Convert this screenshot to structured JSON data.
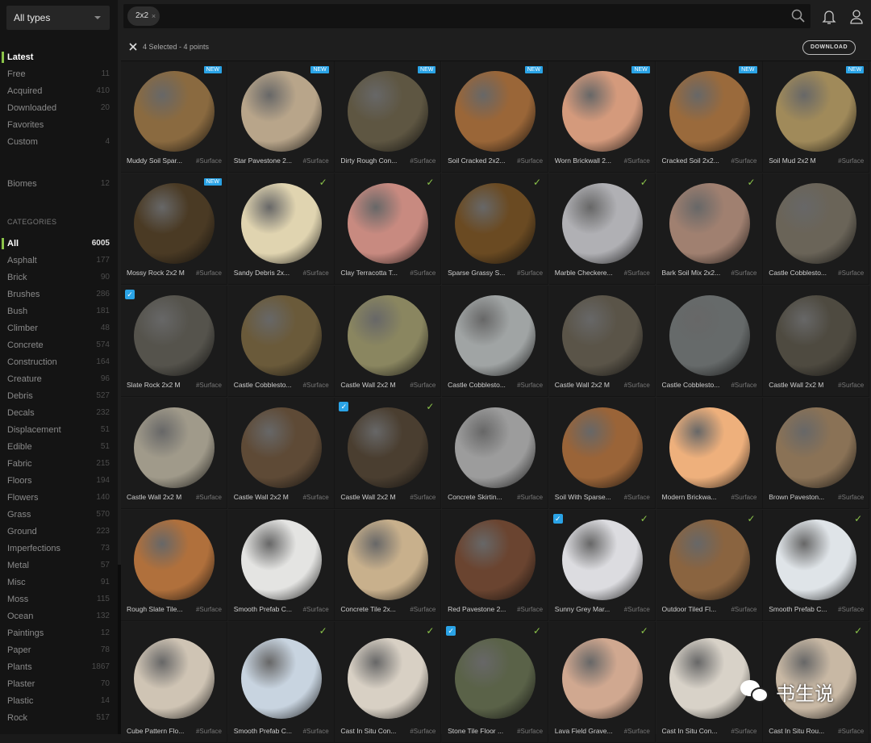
{
  "sidebar": {
    "type_select": "All types",
    "nav": [
      {
        "label": "Latest",
        "count": "",
        "active": true
      },
      {
        "label": "Free",
        "count": "11"
      },
      {
        "label": "Acquired",
        "count": "410"
      },
      {
        "label": "Downloaded",
        "count": "20"
      },
      {
        "label": "Favorites",
        "count": ""
      },
      {
        "label": "Custom",
        "count": "4"
      }
    ],
    "biomes": {
      "label": "Biomes",
      "count": "12"
    },
    "categories_heading": "CATEGORIES",
    "categories": [
      {
        "label": "All",
        "count": "6005",
        "active": true
      },
      {
        "label": "Asphalt",
        "count": "177"
      },
      {
        "label": "Brick",
        "count": "90"
      },
      {
        "label": "Brushes",
        "count": "286"
      },
      {
        "label": "Bush",
        "count": "181"
      },
      {
        "label": "Climber",
        "count": "48"
      },
      {
        "label": "Concrete",
        "count": "574"
      },
      {
        "label": "Construction",
        "count": "164"
      },
      {
        "label": "Creature",
        "count": "96"
      },
      {
        "label": "Debris",
        "count": "527"
      },
      {
        "label": "Decals",
        "count": "232"
      },
      {
        "label": "Displacement",
        "count": "51"
      },
      {
        "label": "Edible",
        "count": "51"
      },
      {
        "label": "Fabric",
        "count": "215"
      },
      {
        "label": "Floors",
        "count": "194"
      },
      {
        "label": "Flowers",
        "count": "140"
      },
      {
        "label": "Grass",
        "count": "570"
      },
      {
        "label": "Ground",
        "count": "223"
      },
      {
        "label": "Imperfections",
        "count": "73"
      },
      {
        "label": "Metal",
        "count": "57"
      },
      {
        "label": "Misc",
        "count": "91"
      },
      {
        "label": "Moss",
        "count": "115"
      },
      {
        "label": "Ocean",
        "count": "132"
      },
      {
        "label": "Paintings",
        "count": "12"
      },
      {
        "label": "Paper",
        "count": "78"
      },
      {
        "label": "Plants",
        "count": "1867"
      },
      {
        "label": "Plaster",
        "count": "70"
      },
      {
        "label": "Plastic",
        "count": "14"
      },
      {
        "label": "Rock",
        "count": "517"
      }
    ]
  },
  "header": {
    "search_chip": "2x2",
    "chip_close": "×",
    "icons": [
      "search-icon",
      "bell-icon",
      "user-icon"
    ]
  },
  "selection": {
    "text": "4 Selected - 4 points",
    "download": "DOWNLOAD"
  },
  "badges": {
    "new": "NEW",
    "check": "✓",
    "checkbox": "✓"
  },
  "accent": {
    "blue": "#2aa3e6",
    "green": "#8bc34a"
  },
  "assets": [
    {
      "name": "Muddy Soil Spar...",
      "tag": "#Surface",
      "color": "#8a6a40",
      "new": true
    },
    {
      "name": "Star Pavestone 2...",
      "tag": "#Surface",
      "color": "#b8a58a",
      "new": true
    },
    {
      "name": "Dirty Rough Con...",
      "tag": "#Surface",
      "color": "#5e5642",
      "new": true
    },
    {
      "name": "Soil Cracked 2x2...",
      "tag": "#Surface",
      "color": "#9a6638",
      "new": true
    },
    {
      "name": "Worn Brickwall 2...",
      "tag": "#Surface",
      "color": "#d49a7c",
      "new": true
    },
    {
      "name": "Cracked Soil 2x2...",
      "tag": "#Surface",
      "color": "#9a6a3c",
      "new": true
    },
    {
      "name": "Soil Mud 2x2 M",
      "tag": "#Surface",
      "color": "#a08a5a",
      "new": true
    },
    {
      "name": "Mossy Rock 2x2 M",
      "tag": "#Surface",
      "color": "#4a3a24",
      "new": true
    },
    {
      "name": "Sandy Debris 2x...",
      "tag": "#Surface",
      "color": "#e0d4b0",
      "check": true
    },
    {
      "name": "Clay Terracotta T...",
      "tag": "#Surface",
      "color": "#c88a80",
      "check": true
    },
    {
      "name": "Sparse Grassy S...",
      "tag": "#Surface",
      "color": "#6a4a22",
      "check": true
    },
    {
      "name": "Marble Checkere...",
      "tag": "#Surface",
      "color": "#b0b0b4",
      "check": true
    },
    {
      "name": "Bark Soil Mix 2x2...",
      "tag": "#Surface",
      "color": "#a08070",
      "check": true
    },
    {
      "name": "Castle Cobblesto...",
      "tag": "#Surface",
      "color": "#6a6458"
    },
    {
      "name": "Slate Rock 2x2 M",
      "tag": "#Surface",
      "color": "#55534c",
      "selected": true
    },
    {
      "name": "Castle Cobblesto...",
      "tag": "#Surface",
      "color": "#6a5a3a"
    },
    {
      "name": "Castle Wall 2x2 M",
      "tag": "#Surface",
      "color": "#8a8660"
    },
    {
      "name": "Castle Cobblesto...",
      "tag": "#Surface",
      "color": "#a0a4a4"
    },
    {
      "name": "Castle Wall 2x2 M",
      "tag": "#Surface",
      "color": "#5a5448"
    },
    {
      "name": "Castle Cobblesto...",
      "tag": "#Surface",
      "color": "#666a6a"
    },
    {
      "name": "Castle Wall 2x2 M",
      "tag": "#Surface",
      "color": "#4e4a40"
    },
    {
      "name": "Castle Wall 2x2 M",
      "tag": "#Surface",
      "color": "#a09a8a"
    },
    {
      "name": "Castle Wall 2x2 M",
      "tag": "#Surface",
      "color": "#5e4a36"
    },
    {
      "name": "Castle Wall 2x2 M",
      "tag": "#Surface",
      "color": "#4a3e30",
      "selected": true,
      "check": true
    },
    {
      "name": "Concrete Skirtin...",
      "tag": "#Surface",
      "color": "#9c9c9c"
    },
    {
      "name": "Soil With Sparse...",
      "tag": "#Surface",
      "color": "#9a6438"
    },
    {
      "name": "Modern Brickwa...",
      "tag": "#Surface",
      "color": "#eeb07c"
    },
    {
      "name": "Brown Paveston...",
      "tag": "#Surface",
      "color": "#8a7256"
    },
    {
      "name": "Rough Slate Tile...",
      "tag": "#Surface",
      "color": "#b0703c"
    },
    {
      "name": "Smooth Prefab C...",
      "tag": "#Surface",
      "color": "#e4e4e2"
    },
    {
      "name": "Concrete Tile 2x...",
      "tag": "#Surface",
      "color": "#c8b08c"
    },
    {
      "name": "Red Pavestone 2...",
      "tag": "#Surface",
      "color": "#6a4430"
    },
    {
      "name": "Sunny Grey Mar...",
      "tag": "#Surface",
      "color": "#dcdce0",
      "selected": true,
      "check": true
    },
    {
      "name": "Outdoor Tiled Fl...",
      "tag": "#Surface",
      "color": "#8a6440",
      "check": true
    },
    {
      "name": "Smooth Prefab C...",
      "tag": "#Surface",
      "color": "#dfe4e8",
      "check": true
    },
    {
      "name": "Cube Pattern Flo...",
      "tag": "#Surface",
      "color": "#cfc4b4"
    },
    {
      "name": "Smooth Prefab C...",
      "tag": "#Surface",
      "color": "#c8d4e0",
      "check": true
    },
    {
      "name": "Cast In Situ Con...",
      "tag": "#Surface",
      "color": "#d8d0c4",
      "check": true
    },
    {
      "name": "Stone Tile Floor ...",
      "tag": "#Surface",
      "color": "#5a6248",
      "selected": true,
      "check": true
    },
    {
      "name": "Lava Field Grave...",
      "tag": "#Surface",
      "color": "#d0a890",
      "check": true
    },
    {
      "name": "Cast In Situ Con...",
      "tag": "#Surface",
      "color": "#d8d2c8"
    },
    {
      "name": "Cast In Situ Rou...",
      "tag": "#Surface",
      "color": "#c8b8a4",
      "check": true
    }
  ],
  "watermark": "书生说"
}
